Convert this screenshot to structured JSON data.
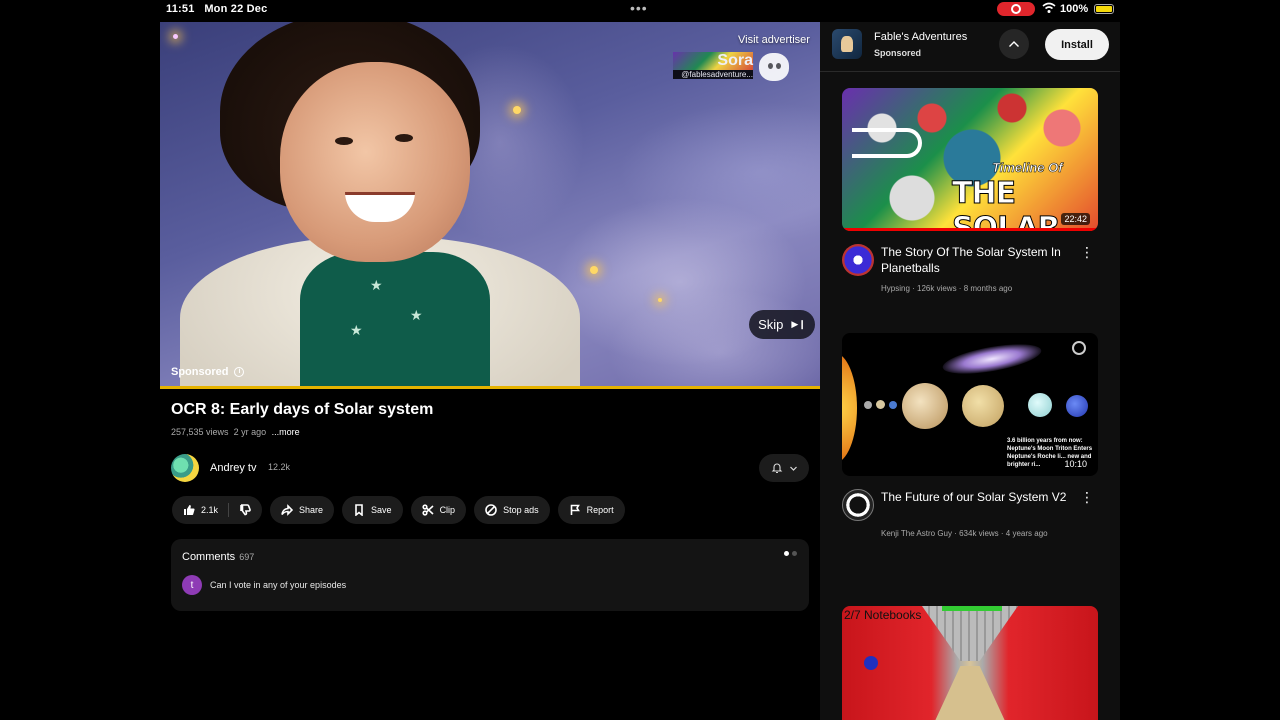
{
  "status": {
    "time": "11:51",
    "date": "Mon 22 Dec",
    "battery": "100%",
    "dots": "•••"
  },
  "video": {
    "visit_advertiser": "Visit advertiser",
    "watermark_name": "Sora",
    "watermark_handle": "@fablesadventure...",
    "sponsored": "Sponsored",
    "skip": "Skip",
    "progress": 1.0
  },
  "title": "OCR 8: Early days of Solar system",
  "meta": {
    "views": "257,535 views",
    "age": "2 yr ago",
    "more": "...more"
  },
  "channel": {
    "name": "Andrey tv",
    "subs": "12.2k"
  },
  "actions": {
    "like_count": "2.1k",
    "share": "Share",
    "save": "Save",
    "clip": "Clip",
    "stop_ads": "Stop ads",
    "report": "Report"
  },
  "comments": {
    "title": "Comments",
    "count": "697",
    "first_avatar": "t",
    "first_text": "Can I vote in any of your episodes"
  },
  "ad": {
    "name": "Fable's Adventures",
    "sponsored": "Sponsored",
    "install": "Install"
  },
  "recommendations": [
    {
      "title": "The Story Of The Solar System In Planetballs",
      "meta": "Hypsing · 126k views · 8 months ago",
      "duration": "22:42",
      "thumb_text_small": "Timeline Of",
      "thumb_text_big": "THE SOLAR",
      "avatar_color": "#3b2bd6"
    },
    {
      "title": "The Future of our Solar System V2",
      "meta": "Kenji The Astro Guy · 634k views · 4 years ago",
      "duration": "10:10",
      "thumb_caption": "3.6 billion years from now: Neptune's Moon Triton Enters Neptune's Roche li... new and brighter ri...",
      "avatar_color": "#ffffff"
    },
    {
      "thumb_hud": "2/7 Notebooks"
    }
  ],
  "colors": {
    "progress": "#e6b300",
    "install_bg": "#f1f1f1",
    "comment_avatar": "#8e3bb5"
  }
}
